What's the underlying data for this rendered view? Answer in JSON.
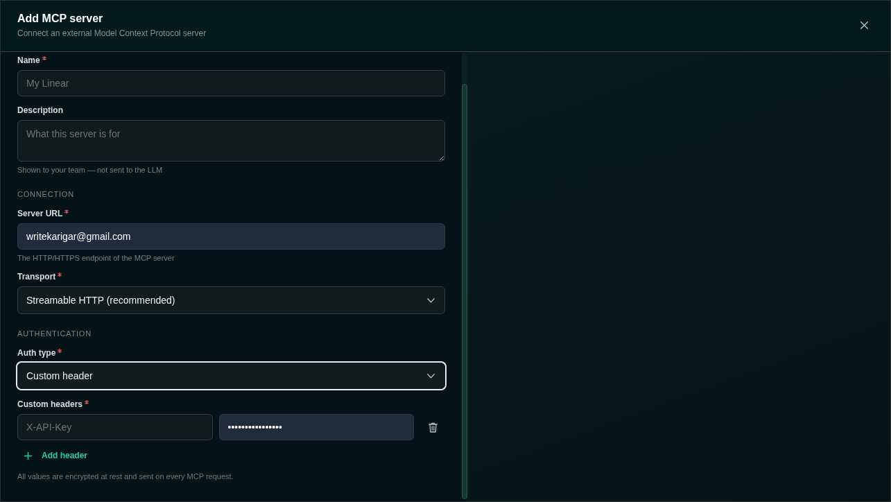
{
  "dialog": {
    "title": "Add MCP server",
    "subtitle": "Connect an external Model Context Protocol server"
  },
  "items": [
    {
      "kind": "input",
      "label": "Name",
      "required": true,
      "placeholder": "My Linear",
      "autofilled": false,
      "focused": false
    },
    {
      "kind": "textarea",
      "label": "Description",
      "required": false,
      "placeholder": "What this server is for",
      "focused": false,
      "help": "Shown to your team — not sent to the LLM"
    },
    {
      "kind": "section",
      "title": "CONNECTION"
    },
    {
      "kind": "input",
      "label": "Server URL",
      "required": true,
      "value": "writekarigar@gmail.com",
      "autofilled": true,
      "focused": false,
      "help": "The HTTP/HTTPS endpoint of the MCP server"
    },
    {
      "kind": "select",
      "label": "Transport",
      "required": true,
      "value": "Streamable HTTP (recommended)",
      "focused": false
    },
    {
      "kind": "section",
      "title": "AUTHENTICATION"
    },
    {
      "kind": "select",
      "label": "Auth type",
      "required": true,
      "value": "Custom header",
      "focused": true
    },
    {
      "kind": "headers",
      "label": "Custom headers",
      "required": true,
      "rows": [
        {
          "key": {
            "placeholder": "X-API-Key",
            "autofilled": false
          },
          "value": {
            "value": "••••••••••••••••",
            "autofilled": true
          }
        }
      ],
      "add_button": "Add header",
      "help": "All values are encrypted at rest and sent on every MCP request."
    }
  ]
}
